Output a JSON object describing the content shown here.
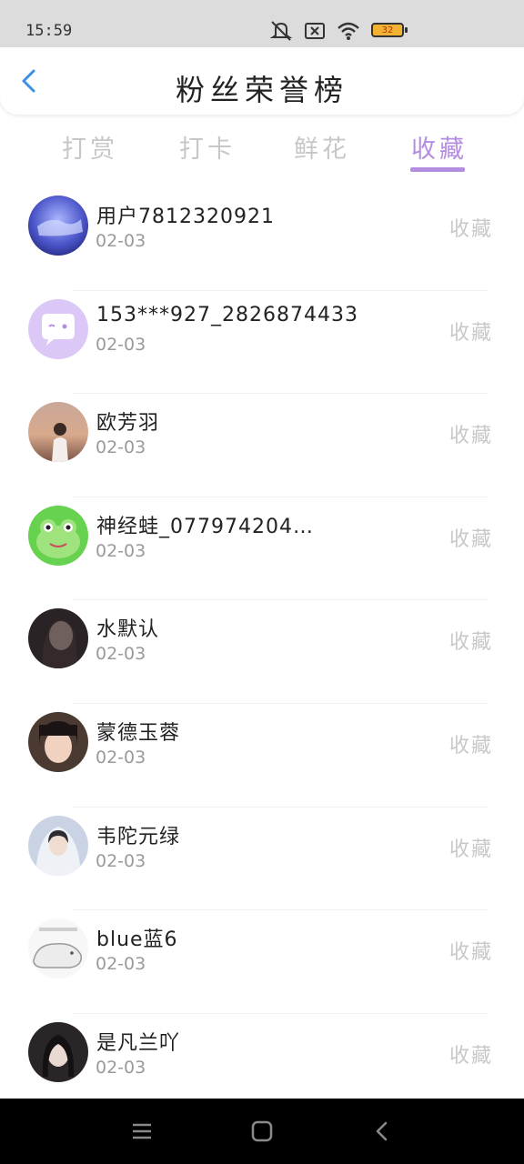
{
  "status_bar": {
    "time": "15:59",
    "icons": [
      "mute-icon",
      "no-sim-icon",
      "wifi-icon",
      "battery-icon"
    ],
    "battery_level": "32"
  },
  "header": {
    "title": "粉丝荣誉榜"
  },
  "tabs": [
    {
      "label": "打赏",
      "active": false
    },
    {
      "label": "打卡",
      "active": false
    },
    {
      "label": "鲜花",
      "active": false
    },
    {
      "label": "收藏",
      "active": true
    }
  ],
  "colors": {
    "accent": "#b38de0",
    "inactive_tab": "#c7c7c7",
    "action_text": "#c8c8c8",
    "date_text": "#9a9a9a"
  },
  "list": [
    {
      "name": "用户7812320921",
      "date": "02-03",
      "action": "收藏",
      "avatar": "avatar-blue-scene"
    },
    {
      "name": "153***927_2826874433",
      "date": "02-03",
      "action": "收藏",
      "avatar": "avatar-default-chat"
    },
    {
      "name": "欧芳羽",
      "date": "02-03",
      "action": "收藏",
      "avatar": "avatar-girl-sunset"
    },
    {
      "name": "神经蛙_077974204…",
      "date": "02-03",
      "action": "收藏",
      "avatar": "avatar-frog"
    },
    {
      "name": "水默认",
      "date": "02-03",
      "action": "收藏",
      "avatar": "avatar-dark-photo"
    },
    {
      "name": "蒙德玉蓉",
      "date": "02-03",
      "action": "收藏",
      "avatar": "avatar-selfie"
    },
    {
      "name": "韦陀元绿",
      "date": "02-03",
      "action": "收藏",
      "avatar": "avatar-girl-veil"
    },
    {
      "name": "blue蓝6",
      "date": "02-03",
      "action": "收藏",
      "avatar": "avatar-hamster-sketch"
    },
    {
      "name": "是凡兰吖",
      "date": "02-03",
      "action": "收藏",
      "avatar": "avatar-dark-portrait"
    }
  ],
  "nav_bar": {
    "buttons": [
      "menu-icon",
      "home-icon",
      "back-icon"
    ]
  }
}
